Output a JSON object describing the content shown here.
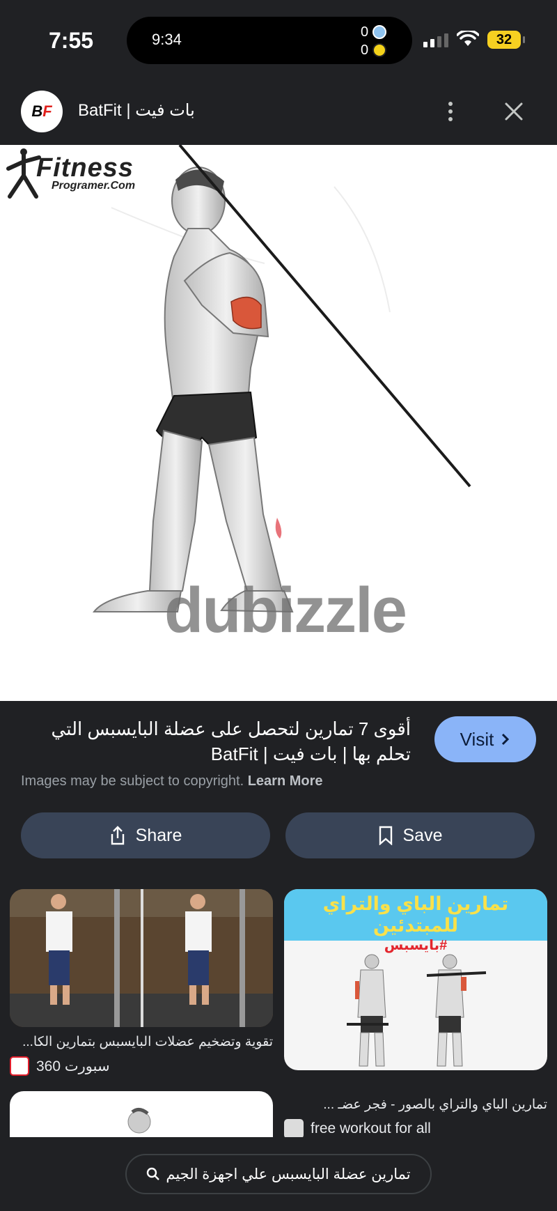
{
  "status_bar": {
    "time": "7:55",
    "island_time": "9:34",
    "score_home": "0",
    "score_away": "0",
    "battery": "32"
  },
  "header": {
    "logo_text_b": "B",
    "logo_text_f": "F",
    "site_name": "BatFit | بات فيت"
  },
  "main_image": {
    "watermark_fitness": "Fitness",
    "watermark_programer": "Programer.Com",
    "watermark_dubizzle": "dubizzle"
  },
  "info": {
    "title": "أقوى 7 تمارين لتحصل على عضلة البايسبس التي تحلم بها | بات فيت | BatFit",
    "visit_label": "Visit",
    "copyright_text": "Images may be subject to copyright.",
    "learn_more": "Learn More"
  },
  "actions": {
    "share_label": "Share",
    "save_label": "Save"
  },
  "related": [
    {
      "caption": "تقوية وتضخيم عضلات البايسبس بتمارين الكا...",
      "source": "سبورت 360"
    },
    {
      "banner_title": "تمارين الباي والتراي للمبتدئين",
      "banner_tag": "#بايسبس",
      "caption": "تمارين الباي والتراي بالصور - فجر عضـ ...",
      "source": "free workout for all"
    }
  ],
  "bottom": {
    "search_query": "تمارين عضلة البايسبس علي اجهزة الجيم"
  },
  "colors": {
    "background": "#202124",
    "visit_button": "#8ab4f8",
    "action_button": "#394457",
    "battery": "#f6d021"
  }
}
